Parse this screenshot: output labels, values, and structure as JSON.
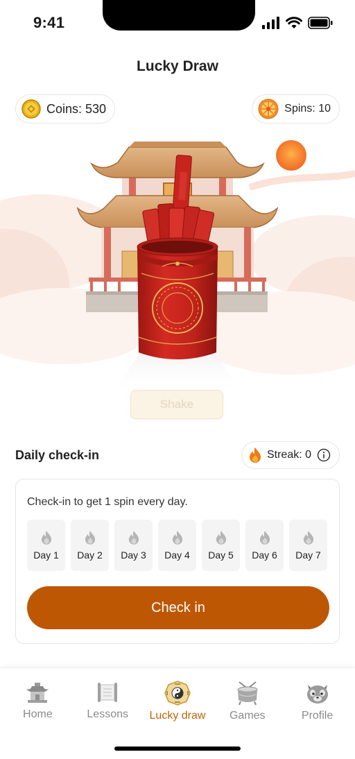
{
  "status": {
    "time": "9:41"
  },
  "header": {
    "title": "Lucky Draw"
  },
  "coins": {
    "label": "Coins: 530"
  },
  "spins": {
    "label": "Spins: 10"
  },
  "shake": {
    "label": "Shake"
  },
  "checkin": {
    "title": "Daily check-in",
    "streak_label": "Streak: 0",
    "description": "Check-in to get 1 spin every day.",
    "days": [
      "Day 1",
      "Day 2",
      "Day 3",
      "Day 4",
      "Day 5",
      "Day 6",
      "Day 7"
    ],
    "button_label": "Check in"
  },
  "tabs": [
    {
      "label": "Home",
      "icon": "pagoda-icon",
      "active": false
    },
    {
      "label": "Lessons",
      "icon": "scroll-icon",
      "active": false
    },
    {
      "label": "Lucky draw",
      "icon": "bagua-icon",
      "active": true
    },
    {
      "label": "Games",
      "icon": "drum-icon",
      "active": false
    },
    {
      "label": "Profile",
      "icon": "red-panda-icon",
      "active": false
    }
  ],
  "colors": {
    "accent": "#bd5703",
    "active_tab": "#c0650a",
    "shake_disabled_bg": "#fbf3e4",
    "cylinder_red": "#c8241e"
  }
}
